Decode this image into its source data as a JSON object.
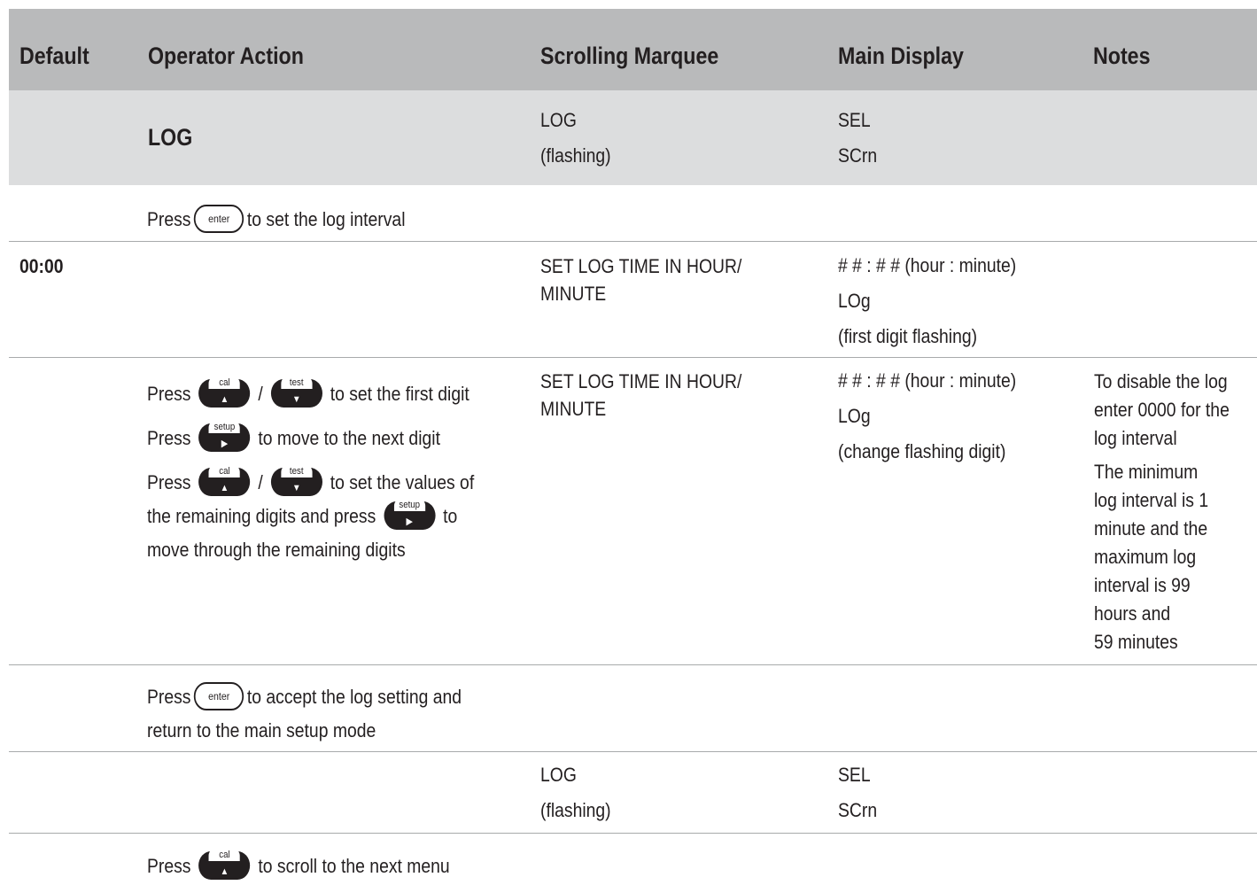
{
  "header": {
    "default": "Default",
    "operator_action": "Operator Action",
    "scrolling_marquee": "Scrolling Marquee",
    "main_display": "Main Display",
    "notes": "Notes"
  },
  "rows": [
    {
      "action": "LOG",
      "marquee": [
        "LOG",
        "(flashing)"
      ],
      "display": [
        "SEL",
        "SCrn"
      ]
    },
    {
      "action_prefix": "Press",
      "button": "enter",
      "action_suffix": "to set the log interval"
    },
    {
      "default": "00:00",
      "marquee": [
        "SET LOG TIME IN HOUR/",
        "MINUTE"
      ],
      "display": [
        "# # : # #  (hour : minute)",
        "LOg",
        "(first digit flashing)"
      ]
    },
    {
      "lines": [
        {
          "prefix": "Press",
          "b1": "cal",
          "sep": "/",
          "b2": "test",
          "suffix": "to set the first digit"
        },
        {
          "prefix": "Press",
          "b1": "setup",
          "suffix": "to move to the next digit"
        },
        {
          "prefix": "Press",
          "b1": "cal",
          "sep": "/",
          "b2": "test",
          "suffix": "to set the values of"
        },
        {
          "prefix": "the remaining digits and press",
          "b1": "setup",
          "suffix": "to"
        },
        {
          "prefix": "move through the remaining digits"
        }
      ],
      "marquee": [
        "SET LOG TIME IN HOUR/",
        "MINUTE"
      ],
      "display": [
        "# # : # #  (hour : minute)",
        "LOg",
        "(change flashing digit)"
      ],
      "notes": [
        "To disable the log",
        "enter 0000 for the",
        "log interval",
        "The minimum",
        "log interval is 1",
        "minute and the",
        "maximum log",
        "interval is 99",
        "hours and",
        "59 minutes"
      ]
    },
    {
      "action_prefix": "Press",
      "button": "enter",
      "action_suffix": "to accept the log setting and",
      "action_line2": "return to the main setup mode"
    },
    {
      "marquee": [
        "LOG",
        "(flashing)"
      ],
      "display": [
        "SEL",
        "SCrn"
      ]
    },
    {
      "action_prefix": "Press",
      "button": "cal",
      "action_suffix": "to scroll to the next menu"
    }
  ]
}
